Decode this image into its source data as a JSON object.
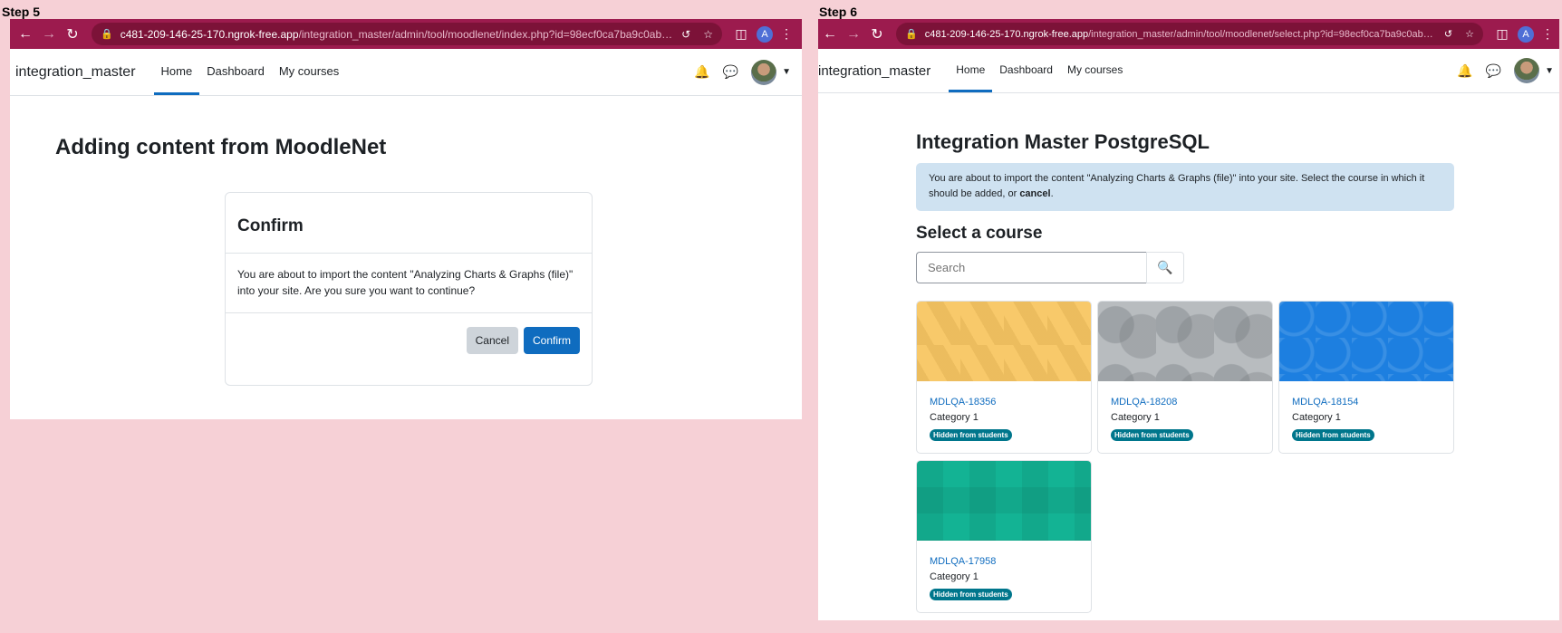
{
  "step5": {
    "label": "Step 5",
    "url_host": "c481-209-146-25-170.ngrok-free.app",
    "url_path": "/integration_master/admin/tool/moodlenet/index.php?id=98ecf0ca7ba9c0ab018654...",
    "account_initial": "A",
    "brand": "integration_master",
    "nav": [
      "Home",
      "Dashboard",
      "My courses"
    ],
    "page_title": "Adding content from MoodleNet",
    "modal": {
      "title": "Confirm",
      "body": "You are about to import the content \"Analyzing Charts & Graphs (file)\" into your site. Are you sure you want to continue?",
      "cancel": "Cancel",
      "confirm": "Confirm"
    }
  },
  "step6": {
    "label": "Step 6",
    "url_host": "c481-209-146-25-170.ngrok-free.app",
    "url_path": "/integration_master/admin/tool/moodlenet/select.php?id=98ecf0ca7ba9c0ab018654...",
    "account_initial": "A",
    "brand": "integration_master",
    "nav": [
      "Home",
      "Dashboard",
      "My courses"
    ],
    "page_title": "Integration Master PostgreSQL",
    "alert_text": "You are about to import the content \"Analyzing Charts & Graphs (file)\" into your site. Select the course in which it should be added, or ",
    "alert_link": "cancel",
    "alert_end": ".",
    "select_heading": "Select a course",
    "search_placeholder": "Search",
    "courses": [
      {
        "name": "MDLQA-18356",
        "category": "Category 1",
        "badge": "Hidden from students",
        "image": "yellow-triangles"
      },
      {
        "name": "MDLQA-18208",
        "category": "Category 1",
        "badge": "Hidden from students",
        "image": "grey-circles"
      },
      {
        "name": "MDLQA-18154",
        "category": "Category 1",
        "badge": "Hidden from students",
        "image": "blue-circles"
      },
      {
        "name": "MDLQA-17958",
        "category": "Category 1",
        "badge": "Hidden from students",
        "image": "green-squares"
      }
    ]
  },
  "colors": {
    "background": "#f6d0d6",
    "browser_chrome": "#9c1b4e",
    "primary": "#0f6cbf",
    "badge": "#00768c",
    "alert": "#cfe2f1"
  }
}
